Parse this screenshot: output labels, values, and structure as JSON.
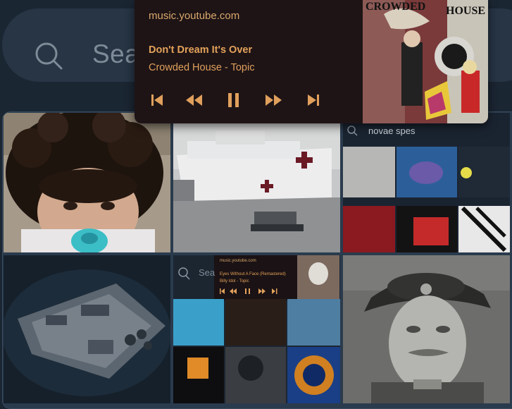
{
  "search": {
    "placeholder": "Sea"
  },
  "player": {
    "site": "music.youtube.com",
    "track_title": "Don't Dream It's Over",
    "artist": "Crowded House - Topic",
    "album_art_text": [
      "CROWDED",
      "HOUSE"
    ],
    "controls": [
      "skip-previous-icon",
      "rewind-icon",
      "pause-icon",
      "fast-forward-icon",
      "skip-next-icon"
    ]
  },
  "tiles": {
    "screenshot_search": "novae spes",
    "mini_search": "Sea",
    "mini_player": {
      "site": "music.youtube.com",
      "track": "Eyes Without A Face (Remastered)",
      "artist": "Billy Idol - Topic"
    }
  },
  "colors": {
    "background": "#1b2633",
    "search_bar": "#273545",
    "player_bg": "#1e1416",
    "player_text": "#e0a05c"
  }
}
